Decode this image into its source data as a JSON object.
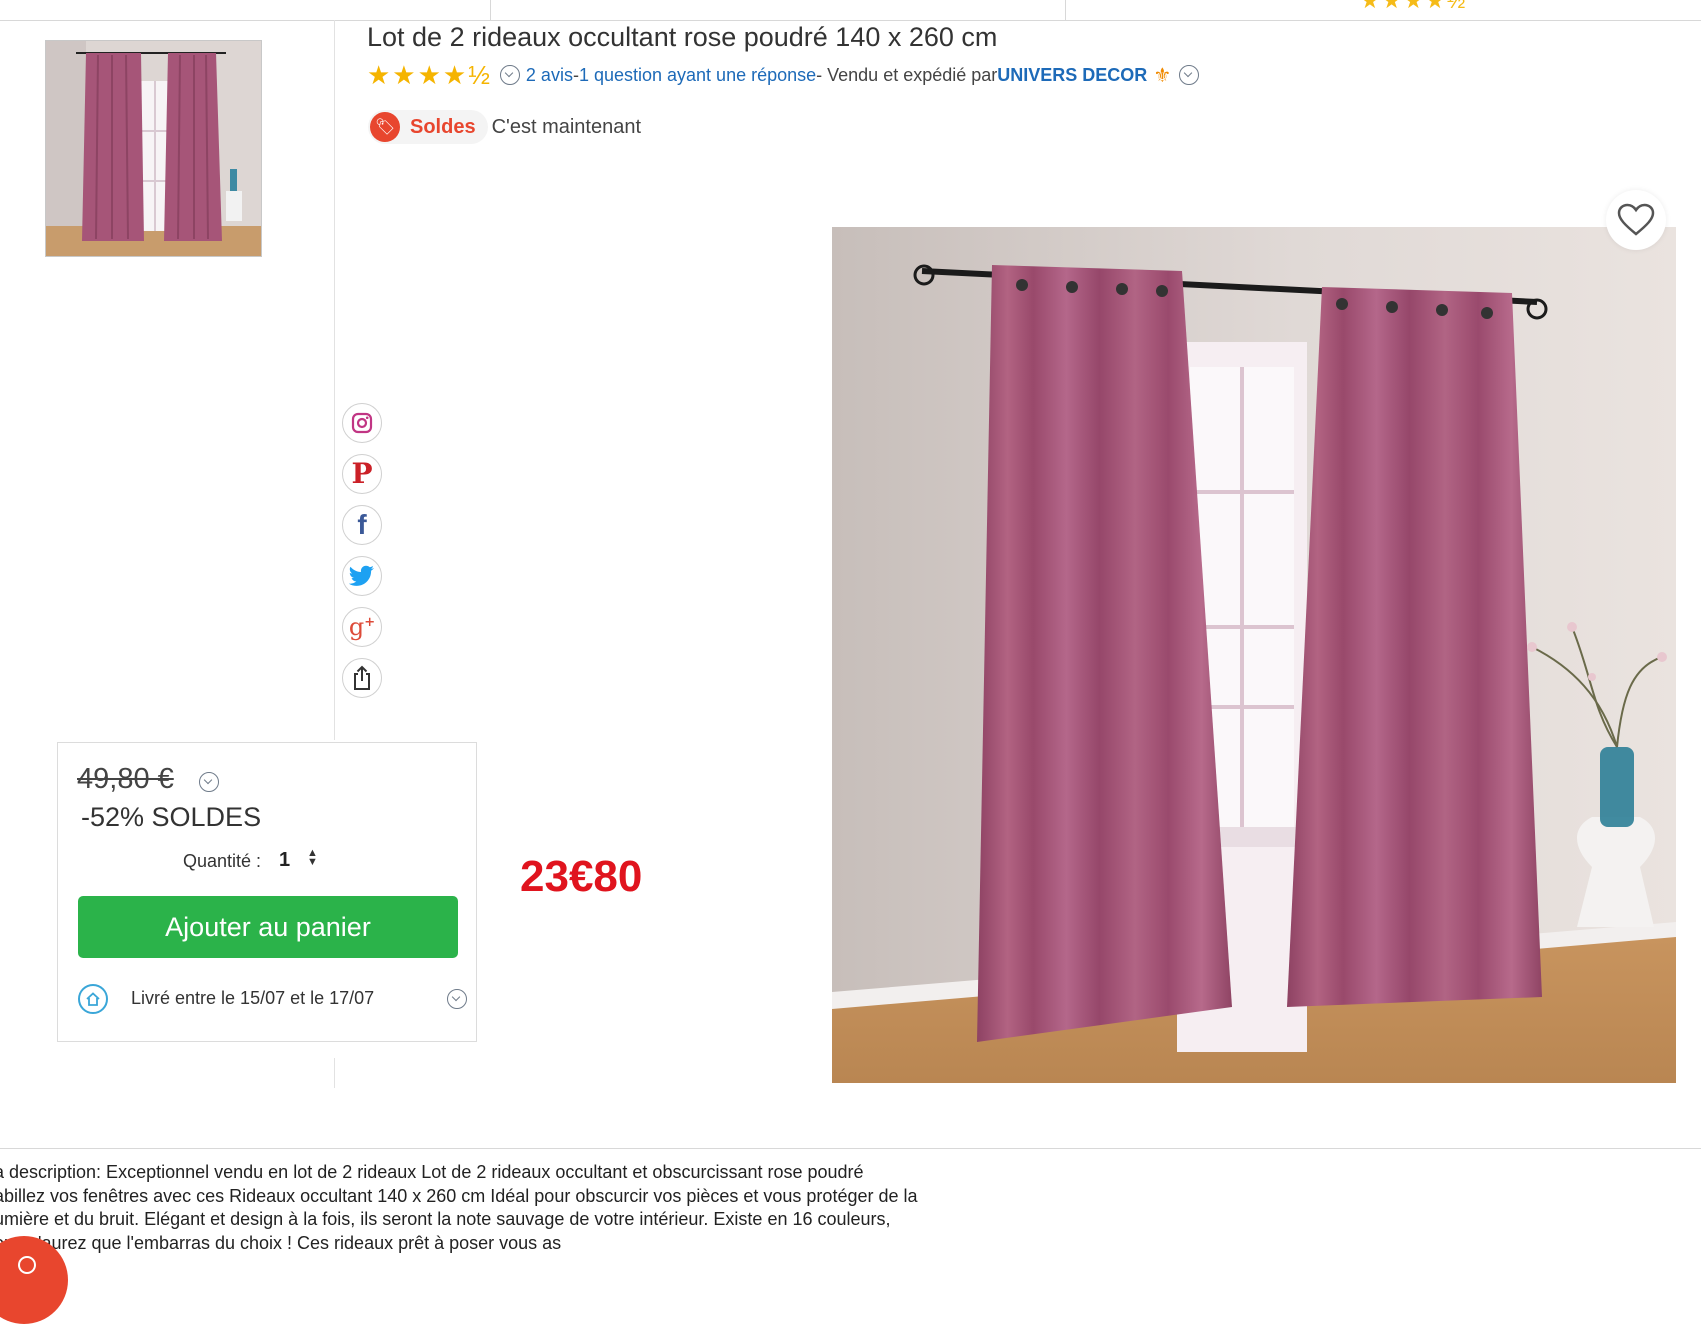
{
  "product": {
    "title": "Lot de 2 rideaux occultant rose poudré 140 x 260 cm",
    "rating_stars": "★★★★½",
    "reviews_link": "2 avis",
    "separator": " - ",
    "question_link": "1 question ayant une réponse",
    "sold_by_text": " - Vendu et expédié par ",
    "seller_name": "UNIVERS DECOR",
    "rating_value": 4.5
  },
  "promo": {
    "badge": "Soldes",
    "text": "C'est maintenant"
  },
  "price": {
    "old": "49,80 €",
    "discount": "-52% SOLDES",
    "new": "23€80",
    "quantity_label": "Quantité :",
    "quantity_value": "1",
    "add_to_cart": "Ajouter au panier",
    "delivery": "Livré entre le 15/07 et le 17/07"
  },
  "share_icons": [
    "instagram-icon",
    "pinterest-icon",
    "facebook-icon",
    "twitter-icon",
    "google-plus-icon",
    "share-icon"
  ],
  "description": {
    "line1": "a description: Exceptionnel vendu en lot de 2 rideaux Lot de 2 rideaux occultant et obscurcissant rose poudré",
    "line2": "abillez vos fenêtres avec ces Rideaux occultant 140 x 260 cm Idéal pour obscurcir vos pièces et vous protéger de la",
    "line3": "umière et du bruit. Elégant et design à la fois, ils seront la note sauvage de votre intérieur. Existe en 16 couleurs,",
    "line4": "ous n'aurez que l'embarras du choix ! Ces rideaux prêt à poser vous as"
  },
  "colors": {
    "accent_red": "#e0141e",
    "cart_green": "#2bb34a",
    "link_blue": "#1d6ab8",
    "star_gold": "#f5b400",
    "curtain_pink": "#a65578"
  }
}
